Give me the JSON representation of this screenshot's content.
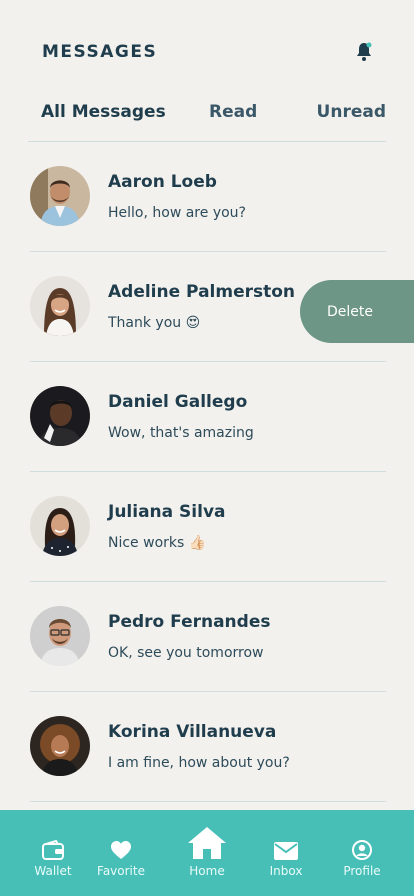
{
  "header": {
    "title": "MESSAGES",
    "bell_icon": "bell-icon"
  },
  "tabs": [
    {
      "label": "All Messages"
    },
    {
      "label": "Read"
    },
    {
      "label": "Unread"
    }
  ],
  "messages": [
    {
      "name": "Aaron Loeb",
      "text": "Hello, how are you?"
    },
    {
      "name": "Adeline Palmerston",
      "text": "Thank you 😍"
    },
    {
      "name": "Daniel Gallego",
      "text": "Wow, that's amazing"
    },
    {
      "name": "Juliana Silva",
      "text": "Nice works 👍🏻"
    },
    {
      "name": "Pedro Fernandes",
      "text": "OK, see you tomorrow"
    },
    {
      "name": "Korina Villanueva",
      "text": "I am fine, how about you?"
    }
  ],
  "swipe_action": {
    "label": "Delete"
  },
  "nav": [
    {
      "label": "Wallet",
      "icon": "wallet-icon"
    },
    {
      "label": "Favorite",
      "icon": "heart-icon"
    },
    {
      "label": "Home",
      "icon": "home-icon"
    },
    {
      "label": "Inbox",
      "icon": "mail-icon"
    },
    {
      "label": "Profile",
      "icon": "profile-icon"
    }
  ],
  "colors": {
    "background": "#f3f1ed",
    "text": "#1f3d4d",
    "nav": "#47bfb7",
    "delete": "#6d9686",
    "divider": "#cfdde0"
  }
}
